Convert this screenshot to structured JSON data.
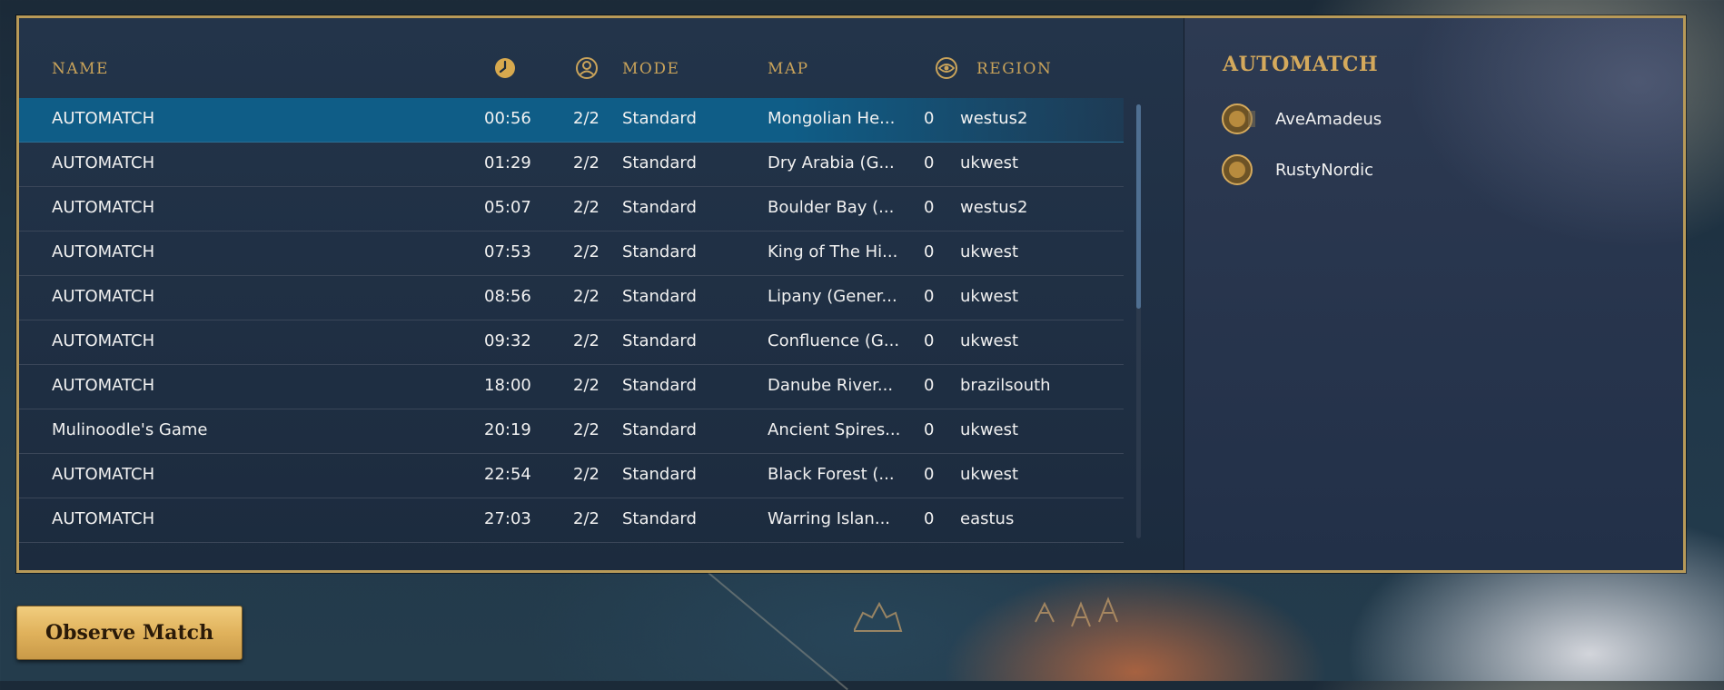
{
  "table": {
    "headers": {
      "name": "NAME",
      "time_icon": "clock-icon",
      "players_icon": "player-icon",
      "mode": "MODE",
      "map": "MAP",
      "observers_icon": "eye-icon",
      "region": "REGION"
    },
    "rows": [
      {
        "name": "AUTOMATCH",
        "time": "00:56",
        "players": "2/2",
        "mode": "Standard",
        "map": "Mongolian He...",
        "observers": "0",
        "region": "westus2",
        "selected": true
      },
      {
        "name": "AUTOMATCH",
        "time": "01:29",
        "players": "2/2",
        "mode": "Standard",
        "map": "Dry Arabia (G...",
        "observers": "0",
        "region": "ukwest"
      },
      {
        "name": "AUTOMATCH",
        "time": "05:07",
        "players": "2/2",
        "mode": "Standard",
        "map": "Boulder Bay (...",
        "observers": "0",
        "region": "westus2"
      },
      {
        "name": "AUTOMATCH",
        "time": "07:53",
        "players": "2/2",
        "mode": "Standard",
        "map": "King of The Hi...",
        "observers": "0",
        "region": "ukwest"
      },
      {
        "name": "AUTOMATCH",
        "time": "08:56",
        "players": "2/2",
        "mode": "Standard",
        "map": "Lipany (Gener...",
        "observers": "0",
        "region": "ukwest"
      },
      {
        "name": "AUTOMATCH",
        "time": "09:32",
        "players": "2/2",
        "mode": "Standard",
        "map": "Confluence (G...",
        "observers": "0",
        "region": "ukwest"
      },
      {
        "name": "AUTOMATCH",
        "time": "18:00",
        "players": "2/2",
        "mode": "Standard",
        "map": "Danube River...",
        "observers": "0",
        "region": "brazilsouth"
      },
      {
        "name": "Mulinoodle's Game",
        "time": "20:19",
        "players": "2/2",
        "mode": "Standard",
        "map": "Ancient Spires...",
        "observers": "0",
        "region": "ukwest"
      },
      {
        "name": "AUTOMATCH",
        "time": "22:54",
        "players": "2/2",
        "mode": "Standard",
        "map": "Black Forest (...",
        "observers": "0",
        "region": "ukwest"
      },
      {
        "name": "AUTOMATCH",
        "time": "27:03",
        "players": "2/2",
        "mode": "Standard",
        "map": "Warring Islan...",
        "observers": "0",
        "region": "eastus"
      }
    ]
  },
  "details": {
    "title": "AUTOMATCH",
    "players": [
      {
        "name": "AveAmadeus",
        "icon": "rank-badge-icon"
      },
      {
        "name": "RustyNordic",
        "icon": "rank-badge-icon"
      }
    ]
  },
  "actions": {
    "observe_label": "Observe Match"
  },
  "colors": {
    "accent_gold": "#c9a35a",
    "selected_row": "#0f5d87",
    "panel_border": "#b89a58"
  }
}
